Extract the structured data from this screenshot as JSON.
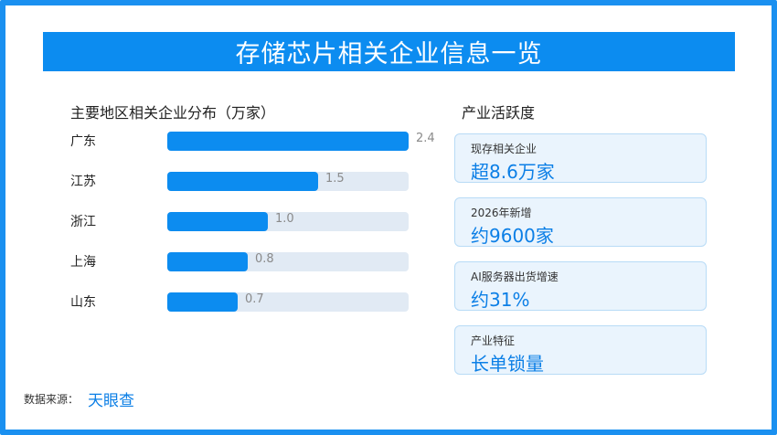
{
  "title": "存储芯片相关企业信息一览",
  "left_section": {
    "title": "主要地区相关企业分布（万家）"
  },
  "right_section": {
    "title": "产业活跃度"
  },
  "chart_data": {
    "type": "bar",
    "orientation": "horizontal",
    "title": "主要地区相关企业分布（万家）",
    "categories": [
      "广东",
      "江苏",
      "浙江",
      "上海",
      "山东"
    ],
    "values": [
      2.4,
      1.5,
      1.0,
      0.8,
      0.7
    ],
    "xlim": [
      0,
      2.4
    ],
    "data_labels": [
      "2.4",
      "1.5",
      "1.0",
      "0.8",
      "0.7"
    ],
    "grid": false,
    "colors": {
      "bar": "#0c8cf0",
      "track": "#e1eaf4"
    }
  },
  "stats": [
    {
      "label": "现存相关企业",
      "value": "超8.6万家"
    },
    {
      "label": "2026年新增",
      "value": "约9600家"
    },
    {
      "label": "AI服务器出货增速",
      "value": "约31%"
    },
    {
      "label": "产业特征",
      "value": "长单锁量"
    }
  ],
  "source": {
    "label": "数据来源：",
    "value": "天眼查"
  },
  "colors": {
    "accent": "#0c8cf0",
    "border": "#1a90f0",
    "card_bg": "#eaf4fd"
  }
}
